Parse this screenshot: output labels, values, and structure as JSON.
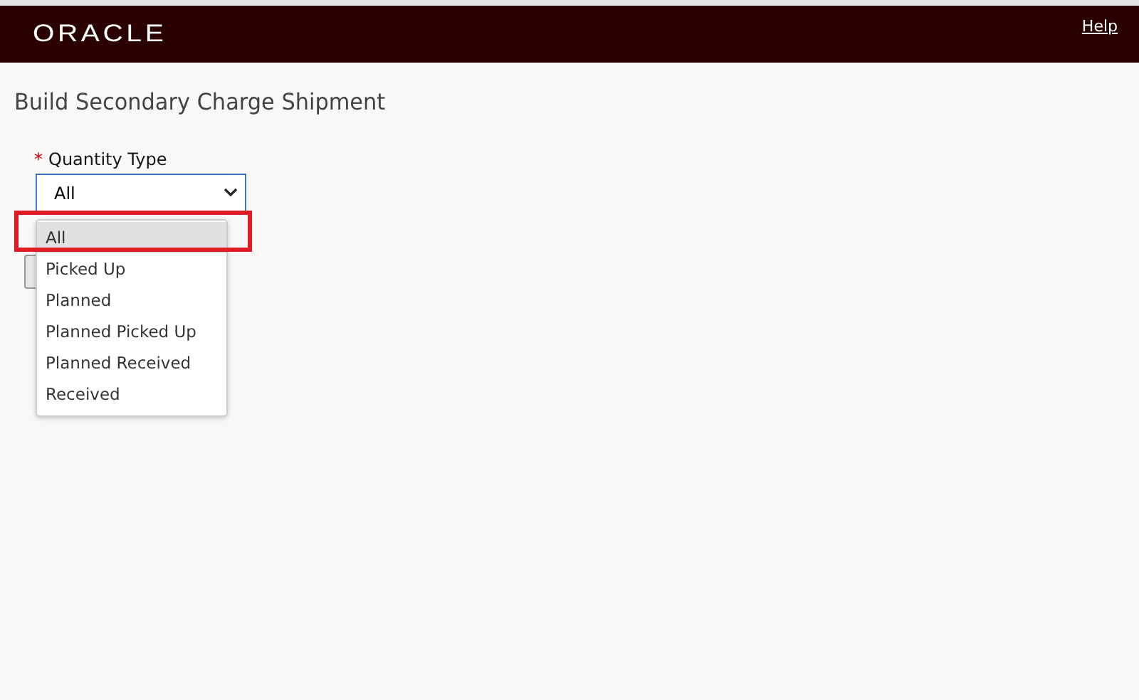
{
  "header": {
    "logo": "ORACLE",
    "help_link": "Help"
  },
  "page_title": "Build Secondary Charge Shipment",
  "field": {
    "label": "Quantity Type",
    "required_mark": "*",
    "value": "All"
  },
  "dropdown": {
    "options": [
      {
        "label": "All",
        "selected": true
      },
      {
        "label": "Picked Up",
        "selected": false
      },
      {
        "label": "Planned",
        "selected": false
      },
      {
        "label": "Planned Picked Up",
        "selected": false
      },
      {
        "label": "Planned Received",
        "selected": false
      },
      {
        "label": "Received",
        "selected": false
      }
    ]
  }
}
